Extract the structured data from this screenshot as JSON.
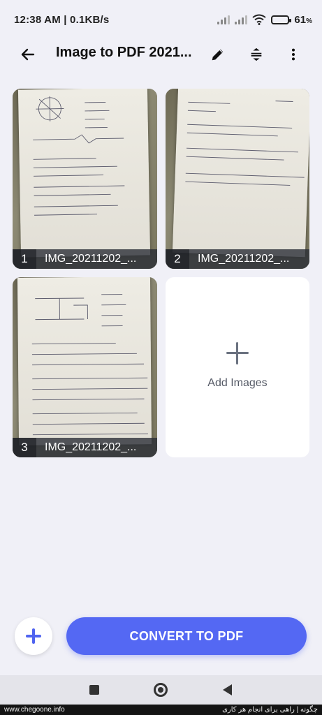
{
  "status_bar": {
    "time_speed": "12:38 AM | 0.1KB/s",
    "battery_percent": "61",
    "battery_unit": "%",
    "battery_level": 0.61
  },
  "app_bar": {
    "title": "Image to PDF 2021...",
    "back_icon": "arrow-left-icon",
    "edit_icon": "pencil-icon",
    "sort_icon": "expand-collapse-icon",
    "more_icon": "more-vertical-icon"
  },
  "images": [
    {
      "index": "1",
      "name": "IMG_20211202_..."
    },
    {
      "index": "2",
      "name": "IMG_20211202_..."
    },
    {
      "index": "3",
      "name": "IMG_20211202_..."
    }
  ],
  "add_images": {
    "label": "Add Images",
    "icon": "plus-icon"
  },
  "actions": {
    "fab_icon": "plus-icon",
    "convert_label": "CONVERT TO PDF"
  },
  "colors": {
    "accent": "#5468f3",
    "background": "#f0f0f7"
  },
  "watermark": {
    "left": "www.chegoone.info",
    "right": "چگونه | راهی برای انجام هر کاری"
  }
}
